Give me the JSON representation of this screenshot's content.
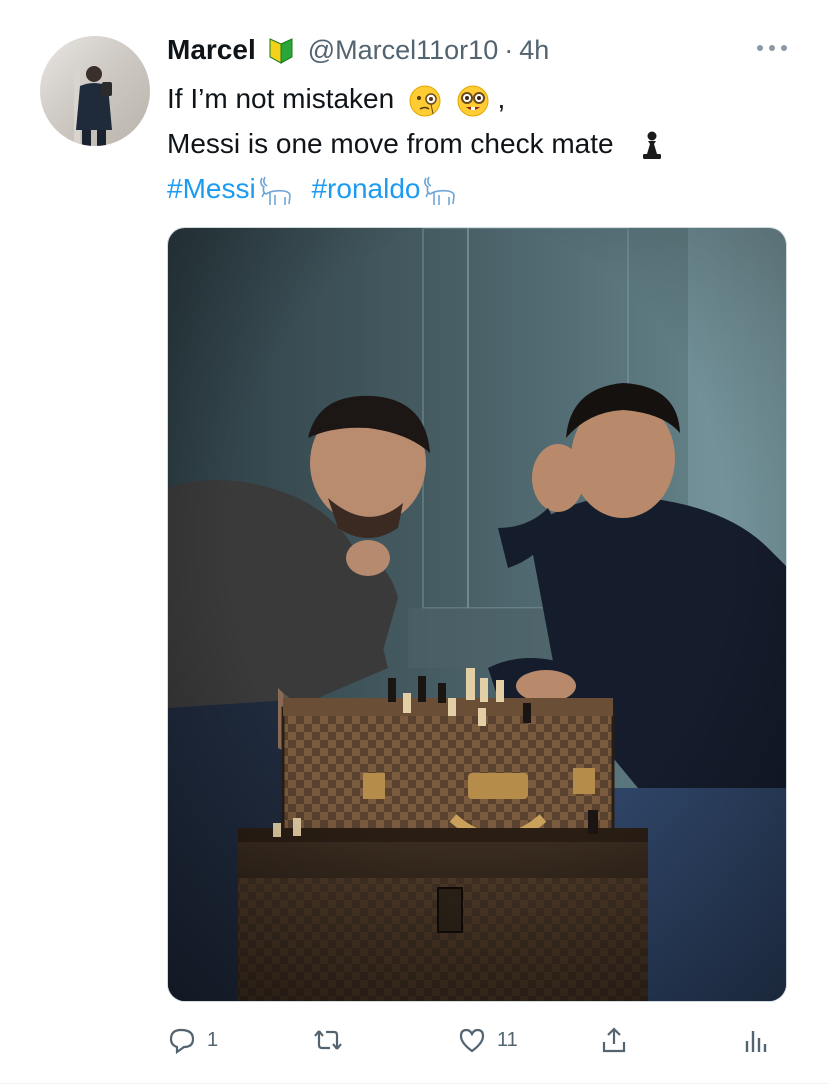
{
  "tweet": {
    "author_name": "Marcel",
    "badge_icon": "beginner-leaf-icon",
    "handle": "@Marcel11or10",
    "separator": "·",
    "time": "4h",
    "line1": "If I’m not mistaken",
    "line1_emojis": [
      "face-with-monocle-emoji",
      "nerd-face-emoji"
    ],
    "line1_suffix": ",",
    "line2": "Messi is one move from check mate",
    "line2_emoji": "chess-pawn-emoji",
    "hashtag1": "#Messi",
    "hashtag2": "#ronaldo",
    "hashtag_emoji": "goat-emoji",
    "link_color": "#1d9bf0"
  },
  "actions": {
    "reply_count": "1",
    "retweet_count": "",
    "like_count": "11",
    "icons": [
      "reply-icon",
      "retweet-icon",
      "like-icon",
      "share-icon",
      "analytics-icon"
    ]
  }
}
